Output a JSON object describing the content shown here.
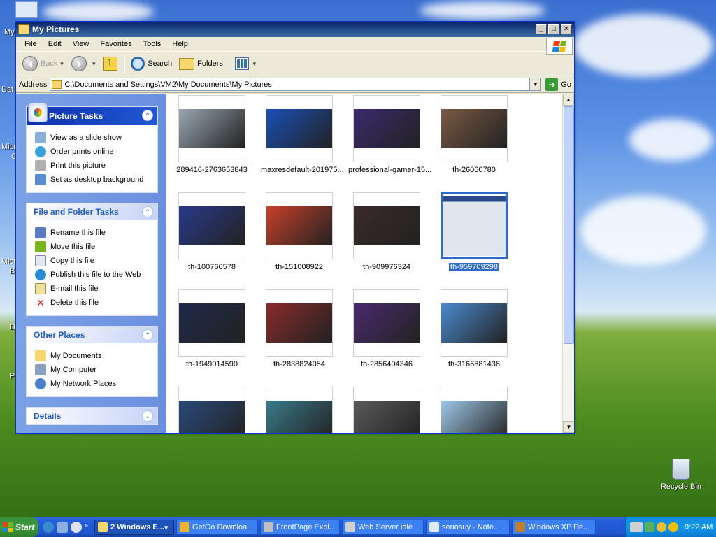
{
  "window": {
    "title": "My Pictures",
    "menu": [
      "File",
      "Edit",
      "View",
      "Favorites",
      "Tools",
      "Help"
    ],
    "toolbar": {
      "back": "Back",
      "search": "Search",
      "folders": "Folders"
    },
    "address": {
      "label": "Address",
      "value": "C:\\Documents and Settings\\VM2\\My Documents\\My Pictures",
      "go": "Go"
    }
  },
  "task_pane": {
    "picture_tasks": {
      "title": "Picture Tasks",
      "items": [
        "View as a slide show",
        "Order prints online",
        "Print this picture",
        "Set as desktop background"
      ]
    },
    "file_folder_tasks": {
      "title": "File and Folder Tasks",
      "items": [
        "Rename this file",
        "Move this file",
        "Copy this file",
        "Publish this file to the Web",
        "E-mail this file",
        "Delete this file"
      ]
    },
    "other_places": {
      "title": "Other Places",
      "items": [
        "My Documents",
        "My Computer",
        "My Network Places"
      ]
    },
    "details": {
      "title": "Details"
    }
  },
  "files": [
    {
      "name": "289416-2763653843",
      "color": "#9aa7b3"
    },
    {
      "name": "maxresdefault-201975...",
      "color": "#1a4fb5"
    },
    {
      "name": "professional-gamer-15...",
      "color": "#3b2a6e"
    },
    {
      "name": "th-26060780",
      "color": "#7a5a45"
    },
    {
      "name": "th-100766578",
      "color": "#2a3a8a"
    },
    {
      "name": "th-151008922",
      "color": "#c8402a"
    },
    {
      "name": "th-909976324",
      "color": "#3b2a2a"
    },
    {
      "name": "th-959709298",
      "color": "#dfe6ee"
    },
    {
      "name": "th-1949014590",
      "color": "#1f2a4a"
    },
    {
      "name": "th-2838824054",
      "color": "#8a2a2a"
    },
    {
      "name": "th-2856404346",
      "color": "#4a2a6e"
    },
    {
      "name": "th-3166881436",
      "color": "#4a8ad0"
    },
    {
      "name": "",
      "color": "#2a4a7a"
    },
    {
      "name": "",
      "color": "#3a7a8a"
    },
    {
      "name": "",
      "color": "#5a5a5a"
    },
    {
      "name": "",
      "color": "#a0c8e8"
    }
  ],
  "selected_file": "th-959709298",
  "desktop": {
    "recycle_bin": "Recycle Bin",
    "left_clipped": [
      "My",
      "Dat",
      "Micro",
      "C",
      "Micro",
      "B",
      "D",
      "P"
    ]
  },
  "taskbar": {
    "start": "Start",
    "tasks": [
      {
        "label": "2 Windows E...",
        "active": true,
        "color": "#f5d76e"
      },
      {
        "label": "GetGo Downloa...",
        "active": false,
        "color": "#f0b030"
      },
      {
        "label": "FrontPage Expl...",
        "active": false,
        "color": "#c0c0c0"
      },
      {
        "label": "Web Server idle",
        "active": false,
        "color": "#d0d0d0"
      },
      {
        "label": "seriosuy - Note...",
        "active": false,
        "color": "#e0e8f0"
      },
      {
        "label": "Windows XP De...",
        "active": false,
        "color": "#c08030"
      }
    ],
    "clock": "9:22 AM"
  }
}
